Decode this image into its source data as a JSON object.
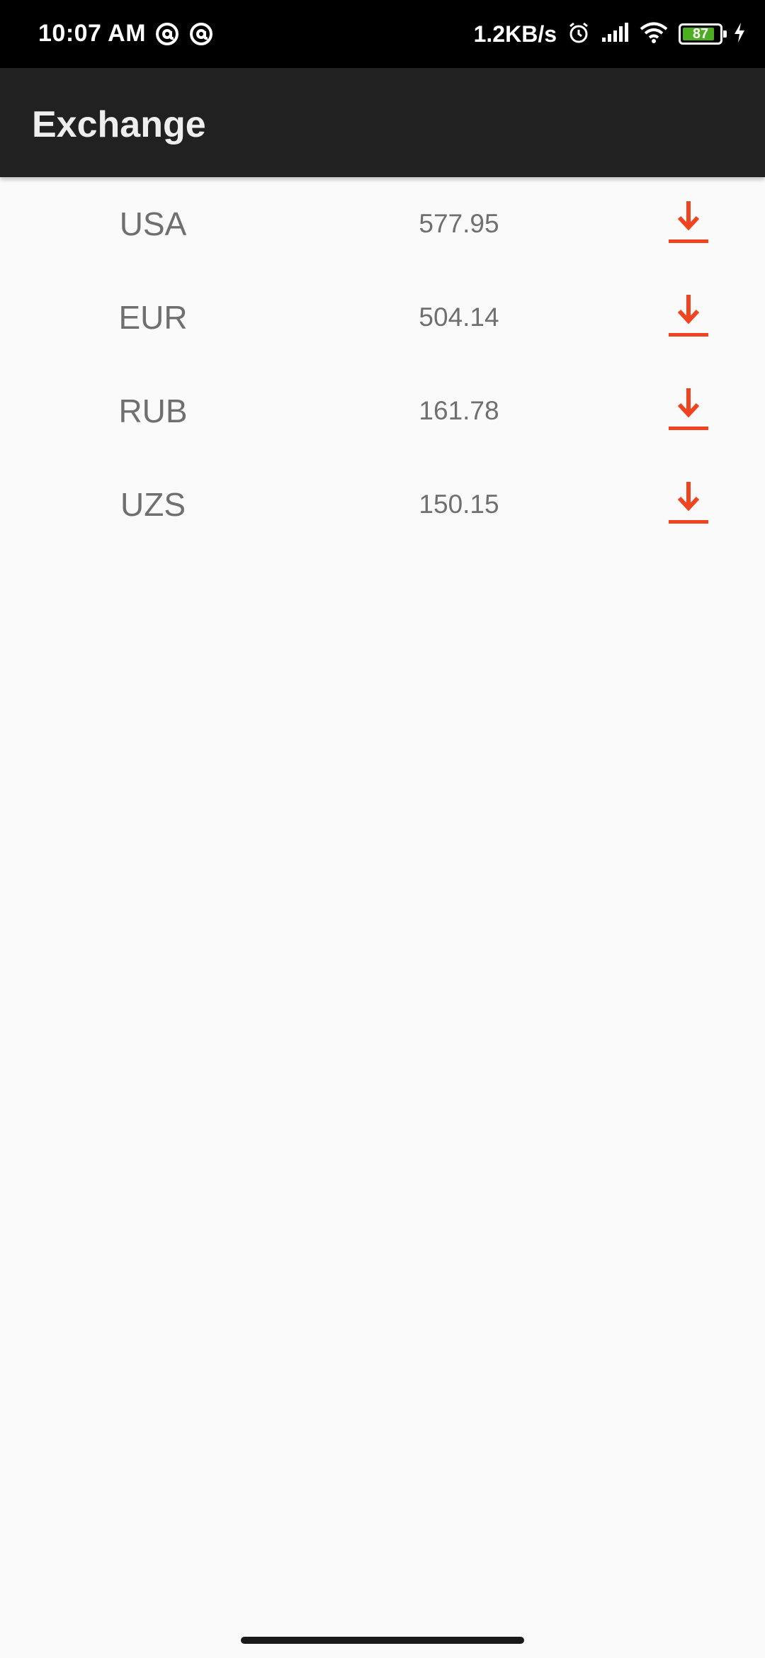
{
  "status_bar": {
    "time": "10:07 AM",
    "network_speed": "1.2KB/s",
    "battery_level": "87",
    "battery_fraction": 0.87,
    "icons": [
      "at-sign-icon",
      "at-sign-icon",
      "alarm-icon",
      "signal-icon",
      "wifi-icon",
      "battery-icon",
      "charging-icon"
    ]
  },
  "app_bar": {
    "title": "Exchange"
  },
  "rates": [
    {
      "code": "USA",
      "value": "577.95"
    },
    {
      "code": "EUR",
      "value": "504.14"
    },
    {
      "code": "RUB",
      "value": "161.78"
    },
    {
      "code": "UZS",
      "value": "150.15"
    }
  ],
  "colors": {
    "accent": "#f0431f",
    "app_bar": "#212121",
    "background": "#fafafa",
    "text": "#6f6f6f"
  }
}
